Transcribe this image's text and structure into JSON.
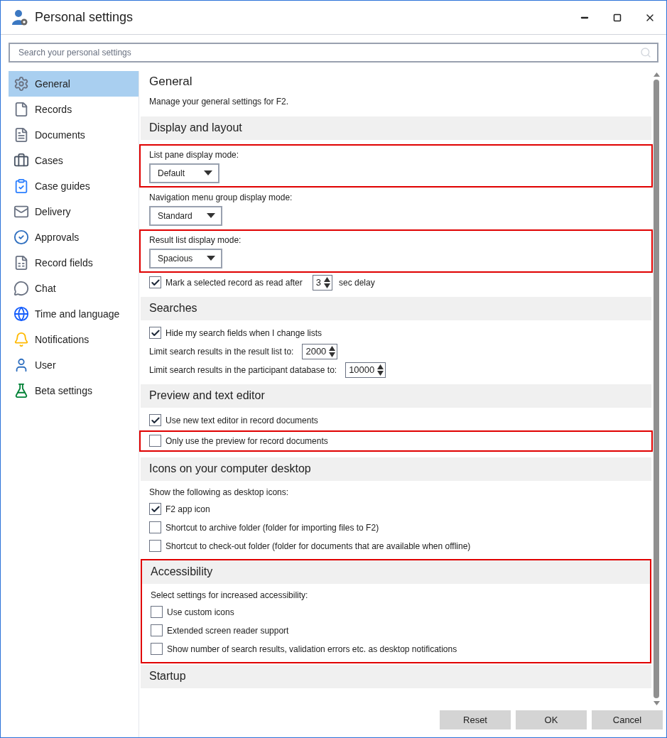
{
  "window": {
    "title": "Personal settings"
  },
  "search": {
    "placeholder": "Search your personal settings"
  },
  "sidebar": {
    "items": [
      {
        "label": "General",
        "selected": true
      },
      {
        "label": "Records",
        "selected": false
      },
      {
        "label": "Documents",
        "selected": false
      },
      {
        "label": "Cases",
        "selected": false
      },
      {
        "label": "Case guides",
        "selected": false
      },
      {
        "label": "Delivery",
        "selected": false
      },
      {
        "label": "Approvals",
        "selected": false
      },
      {
        "label": "Record fields",
        "selected": false
      },
      {
        "label": "Chat",
        "selected": false
      },
      {
        "label": "Time and language",
        "selected": false
      },
      {
        "label": "Notifications",
        "selected": false
      },
      {
        "label": "User",
        "selected": false
      },
      {
        "label": "Beta settings",
        "selected": false
      }
    ]
  },
  "page": {
    "title": "General",
    "subtitle": "Manage your general settings for F2."
  },
  "sections": [
    {
      "title": "Display and layout",
      "highlighted": false,
      "rows": [
        {
          "kind": "dropdown",
          "label": "List pane display mode:",
          "value": "Default",
          "highlighted": true
        },
        {
          "kind": "dropdown",
          "label": "Navigation menu group display mode:",
          "value": "Standard",
          "highlighted": false
        },
        {
          "kind": "dropdown",
          "label": "Result list display mode:",
          "value": "Spacious",
          "highlighted": true
        },
        {
          "kind": "delay",
          "label": "Mark a selected record as read after",
          "value": "3",
          "suffix": "sec delay",
          "checked": true,
          "highlighted": false
        }
      ]
    },
    {
      "title": "Searches",
      "highlighted": false,
      "rows": [
        {
          "kind": "checkbox",
          "label": "Hide my search fields when I change lists",
          "checked": true,
          "highlighted": false
        },
        {
          "kind": "number",
          "label": "Limit search results in the result list to:",
          "value": "2000",
          "highlighted": false
        },
        {
          "kind": "number",
          "label": "Limit search results in the participant database to:",
          "value": "10000",
          "highlighted": false
        }
      ]
    },
    {
      "title": "Preview and text editor",
      "highlighted": false,
      "rows": [
        {
          "kind": "checkbox",
          "label": "Use new text editor in record documents",
          "checked": true,
          "highlighted": false
        },
        {
          "kind": "checkbox",
          "label": "Only use the preview for record documents",
          "checked": false,
          "highlighted": true
        }
      ]
    },
    {
      "title": "Icons on your computer desktop",
      "highlighted": false,
      "rows": [
        {
          "kind": "text",
          "label": "Show the following as desktop icons:",
          "highlighted": false
        },
        {
          "kind": "checkbox",
          "label": "F2 app icon",
          "checked": true,
          "highlighted": false
        },
        {
          "kind": "checkbox",
          "label": "Shortcut to archive folder (folder for importing files to F2)",
          "checked": false,
          "highlighted": false
        },
        {
          "kind": "checkbox",
          "label": "Shortcut to check-out folder (folder for documents that are available when offline)",
          "checked": false,
          "highlighted": false
        }
      ]
    },
    {
      "title": "Accessibility",
      "highlighted": true,
      "rows": [
        {
          "kind": "text",
          "label": "Select settings for increased accessibility:",
          "highlighted": false
        },
        {
          "kind": "checkbox",
          "label": "Use custom icons",
          "checked": false,
          "highlighted": false
        },
        {
          "kind": "checkbox",
          "label": "Extended screen reader support",
          "checked": false,
          "highlighted": false
        },
        {
          "kind": "checkbox",
          "label": "Show number of search results, validation errors etc. as desktop notifications",
          "checked": false,
          "highlighted": false
        }
      ]
    },
    {
      "title": "Startup",
      "highlighted": false
    }
  ],
  "buttons": [
    "Reset",
    "OK",
    "Cancel"
  ]
}
